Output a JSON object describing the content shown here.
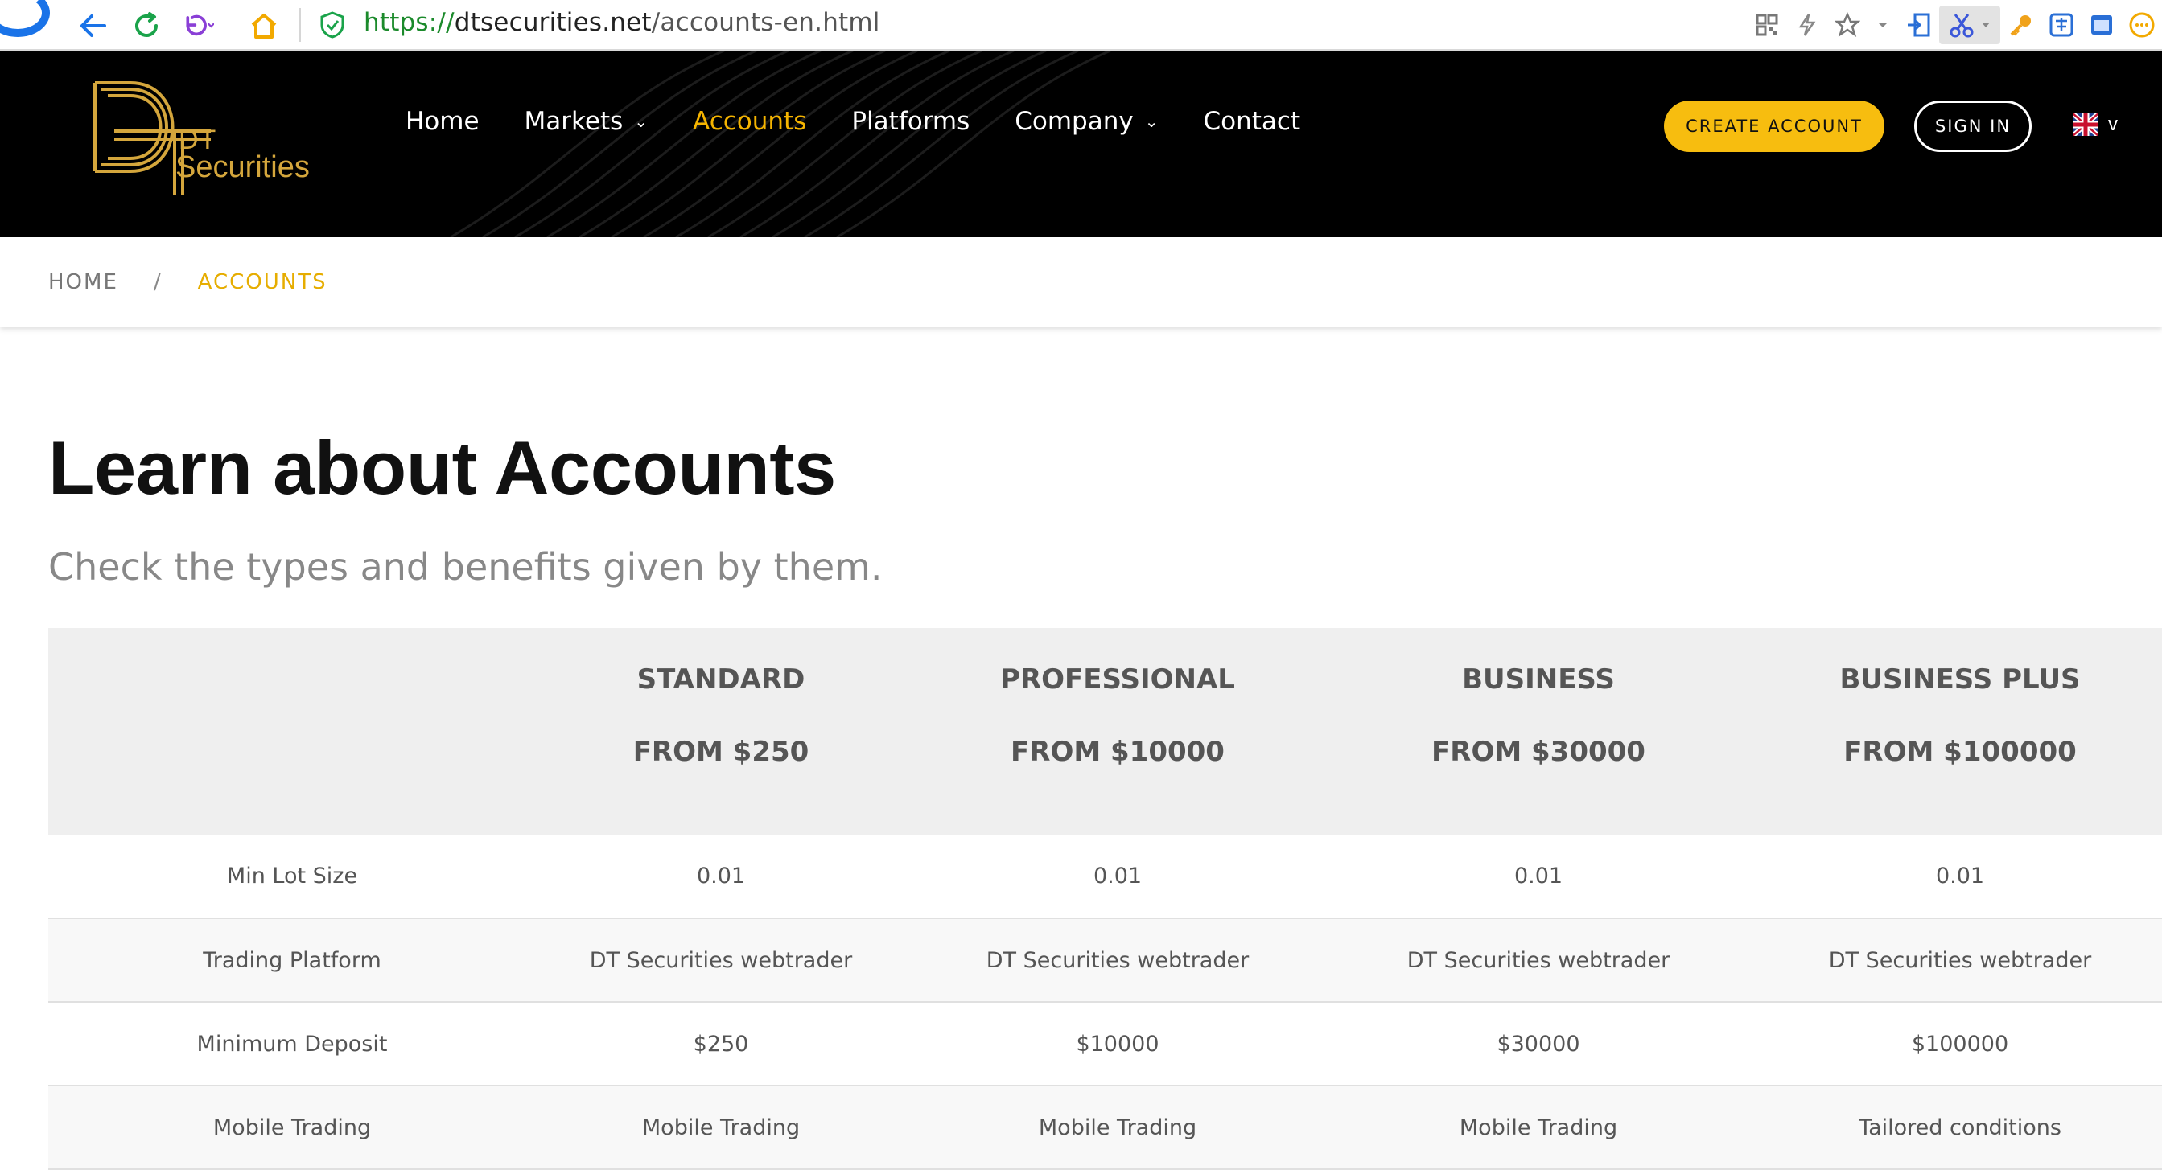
{
  "browser": {
    "url_protocol": "https://",
    "url_host": "dtsecurities.net",
    "url_path": "/accounts-en.html"
  },
  "site": {
    "logo_line1": "DT",
    "logo_line2": "Securities",
    "nav": [
      {
        "label": "Home",
        "has_dropdown": false,
        "active": false
      },
      {
        "label": "Markets",
        "has_dropdown": true,
        "active": false
      },
      {
        "label": "Accounts",
        "has_dropdown": false,
        "active": true
      },
      {
        "label": "Platforms",
        "has_dropdown": false,
        "active": false
      },
      {
        "label": "Company",
        "has_dropdown": true,
        "active": false
      },
      {
        "label": "Contact",
        "has_dropdown": false,
        "active": false
      }
    ],
    "create_account_label": "CREATE ACCOUNT",
    "sign_in_label": "SIGN IN",
    "language_caret": "v",
    "accent_color": "#f7bd0f"
  },
  "breadcrumb": {
    "home": "HOME",
    "separator": "/",
    "current": "ACCOUNTS"
  },
  "content": {
    "title": "Learn about Accounts",
    "subtitle": "Check the types and benefits given by them."
  },
  "accounts_table": {
    "plans": [
      {
        "name": "STANDARD",
        "price": "FROM $250"
      },
      {
        "name": "PROFESSIONAL",
        "price": "FROM $10000"
      },
      {
        "name": "BUSINESS",
        "price": "FROM $30000"
      },
      {
        "name": "BUSINESS PLUS",
        "price": "FROM $100000"
      }
    ],
    "rows": [
      {
        "label": "Min Lot Size",
        "values": [
          "0.01",
          "0.01",
          "0.01",
          "0.01"
        ]
      },
      {
        "label": "Trading Platform",
        "values": [
          "DT Securities webtrader",
          "DT Securities webtrader",
          "DT Securities webtrader",
          "DT Securities webtrader"
        ]
      },
      {
        "label": "Minimum Deposit",
        "values": [
          "$250",
          "$10000",
          "$30000",
          "$100000"
        ]
      },
      {
        "label": "Mobile Trading",
        "values": [
          "Mobile Trading",
          "Mobile Trading",
          "Mobile Trading",
          "Tailored conditions"
        ]
      }
    ]
  }
}
